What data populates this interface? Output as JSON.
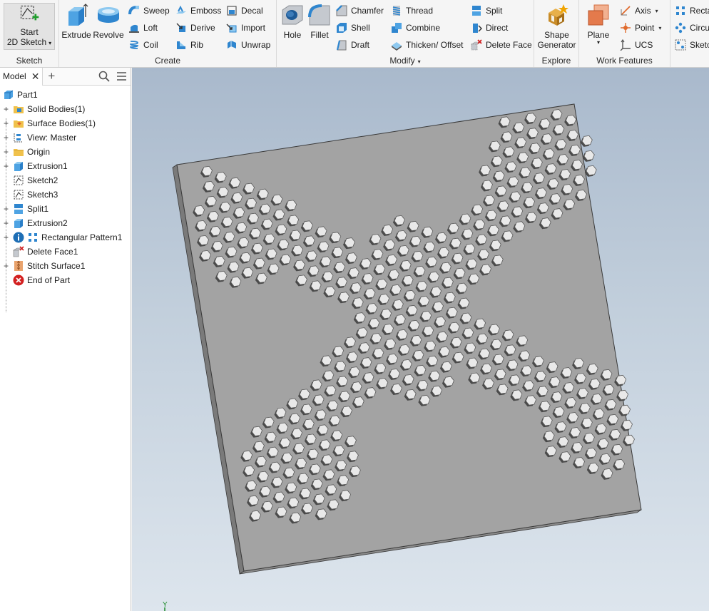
{
  "ribbon": {
    "sketch_panel": {
      "title": "Sketch",
      "start_sketch": {
        "line1": "Start",
        "line2": "2D Sketch",
        "dropdown": "▾"
      }
    },
    "create_panel": {
      "title": "Create",
      "extrude": "Extrude",
      "revolve": "Revolve",
      "sweep": "Sweep",
      "loft": "Loft",
      "coil": "Coil",
      "emboss": "Emboss",
      "derive": "Derive",
      "rib": "Rib",
      "decal": "Decal",
      "import": "Import",
      "unwrap": "Unwrap"
    },
    "modify_panel": {
      "title": "Modify",
      "title_dropdown": "▾",
      "hole": "Hole",
      "fillet": "Fillet",
      "chamfer": "Chamfer",
      "shell": "Shell",
      "draft": "Draft",
      "thread": "Thread",
      "combine": "Combine",
      "thicken_offset": "Thicken/ Offset",
      "split": "Split",
      "direct": "Direct",
      "delete_face": "Delete Face"
    },
    "explore_panel": {
      "title": "Explore",
      "shape_generator": {
        "line1": "Shape",
        "line2": "Generator"
      }
    },
    "work_features_panel": {
      "title": "Work Features",
      "plane": "Plane",
      "plane_dropdown": "▾",
      "axis": "Axis",
      "point": "Point",
      "ucs": "UCS",
      "dropdown": "▾"
    },
    "pattern_panel": {
      "rectangular": "Recta",
      "circular": "Circu",
      "sketch_driven": "Sketc"
    }
  },
  "browser": {
    "tab_label": "Model",
    "close_glyph": "✕",
    "add_glyph": "+",
    "tree": [
      {
        "label": "Part1",
        "icon": "part-icon",
        "expander": ""
      },
      {
        "label": "Solid Bodies(1)",
        "icon": "solid-bodies-folder-icon",
        "expander": "+"
      },
      {
        "label": "Surface Bodies(1)",
        "icon": "surface-bodies-folder-icon",
        "expander": "+"
      },
      {
        "label": "View: Master",
        "icon": "view-rep-icon",
        "expander": "+"
      },
      {
        "label": "Origin",
        "icon": "origin-folder-icon",
        "expander": "+"
      },
      {
        "label": "Extrusion1",
        "icon": "extrusion-icon",
        "expander": "+"
      },
      {
        "label": "Sketch2",
        "icon": "sketch-icon",
        "expander": ""
      },
      {
        "label": "Sketch3",
        "icon": "sketch-icon",
        "expander": ""
      },
      {
        "label": "Split1",
        "icon": "split-icon",
        "expander": "+"
      },
      {
        "label": "Extrusion2",
        "icon": "extrusion-icon",
        "expander": "+"
      },
      {
        "label": "Rectangular Pattern1",
        "icon": "rectangular-pattern-icon",
        "expander": "+"
      },
      {
        "label": "Delete Face1",
        "icon": "delete-face-icon",
        "expander": ""
      },
      {
        "label": "Stitch Surface1",
        "icon": "stitch-surface-icon",
        "expander": "+"
      },
      {
        "label": "End of Part",
        "icon": "end-of-part-icon",
        "expander": ""
      }
    ]
  },
  "viewport": {
    "triad_label": "Y",
    "background_top": "#a9b9cc",
    "background_bottom": "#dde5ed",
    "plate_color": "#a3a3a3",
    "hex_color": "#e9e9e9",
    "hex_shadow": "#4a4a4a"
  }
}
